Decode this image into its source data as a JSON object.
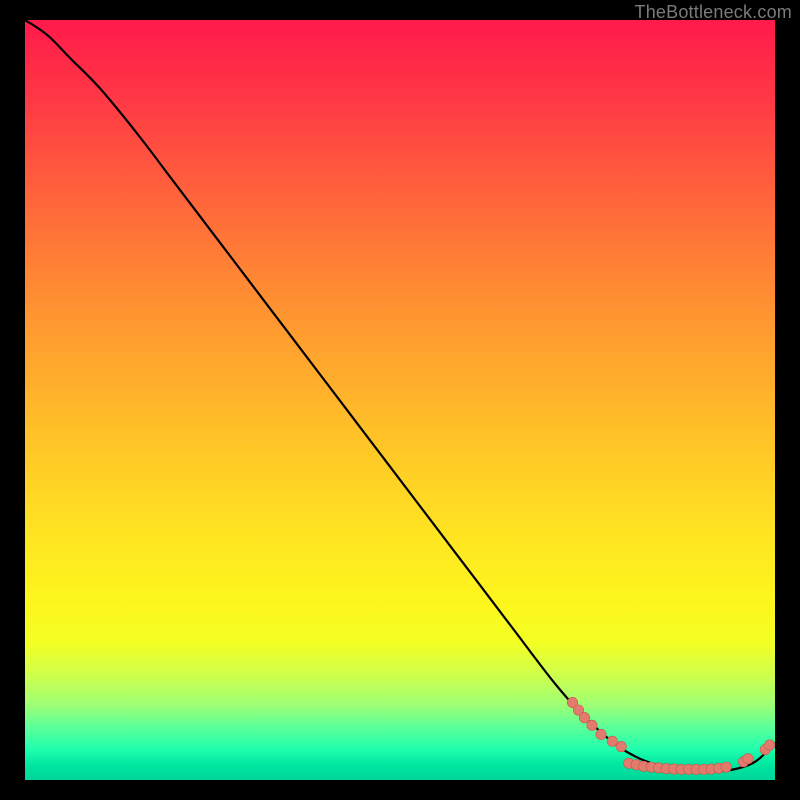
{
  "watermark": "TheBottleneck.com",
  "colors": {
    "background": "#000000",
    "curve": "#000000",
    "dot_fill": "#e07b6e",
    "dot_stroke": "#c8584c"
  },
  "chart_data": {
    "type": "line",
    "title": "",
    "xlabel": "",
    "ylabel": "",
    "xlim": [
      0,
      100
    ],
    "ylim": [
      0,
      100
    ],
    "curve": {
      "name": "bottleneck-curve",
      "x": [
        0,
        3,
        6,
        10,
        15,
        20,
        25,
        30,
        35,
        40,
        45,
        50,
        55,
        60,
        65,
        70,
        73,
        76,
        79,
        82,
        85,
        88,
        91,
        94,
        97,
        99,
        100
      ],
      "y": [
        100,
        98,
        95,
        91,
        85,
        78.5,
        72,
        65.5,
        59,
        52.5,
        46,
        39.5,
        33,
        26.5,
        20,
        13.5,
        10,
        7,
        4.5,
        2.8,
        1.8,
        1.3,
        1.2,
        1.3,
        2.2,
        3.8,
        4.8
      ]
    },
    "dot_clusters": [
      {
        "name": "upper-scatter",
        "points": [
          {
            "x": 73.0,
            "y": 10.2
          },
          {
            "x": 73.8,
            "y": 9.2
          },
          {
            "x": 74.6,
            "y": 8.2
          },
          {
            "x": 75.6,
            "y": 7.2
          },
          {
            "x": 76.8,
            "y": 6.0
          },
          {
            "x": 78.3,
            "y": 5.1
          },
          {
            "x": 79.5,
            "y": 4.4
          }
        ]
      },
      {
        "name": "valley-scatter",
        "points": [
          {
            "x": 80.5,
            "y": 2.2
          },
          {
            "x": 81.5,
            "y": 2.0
          },
          {
            "x": 82.5,
            "y": 1.8
          },
          {
            "x": 83.5,
            "y": 1.7
          },
          {
            "x": 84.5,
            "y": 1.6
          },
          {
            "x": 85.5,
            "y": 1.5
          },
          {
            "x": 86.5,
            "y": 1.45
          },
          {
            "x": 87.5,
            "y": 1.4
          },
          {
            "x": 88.5,
            "y": 1.4
          },
          {
            "x": 89.5,
            "y": 1.4
          },
          {
            "x": 90.5,
            "y": 1.4
          },
          {
            "x": 91.5,
            "y": 1.45
          },
          {
            "x": 92.5,
            "y": 1.55
          },
          {
            "x": 93.5,
            "y": 1.7
          }
        ]
      },
      {
        "name": "narrow-gap",
        "points": [
          {
            "x": 95.8,
            "y": 2.4
          },
          {
            "x": 96.4,
            "y": 2.8
          }
        ]
      },
      {
        "name": "tail-scatter",
        "points": [
          {
            "x": 98.7,
            "y": 4.0
          },
          {
            "x": 99.3,
            "y": 4.6
          }
        ]
      }
    ]
  }
}
